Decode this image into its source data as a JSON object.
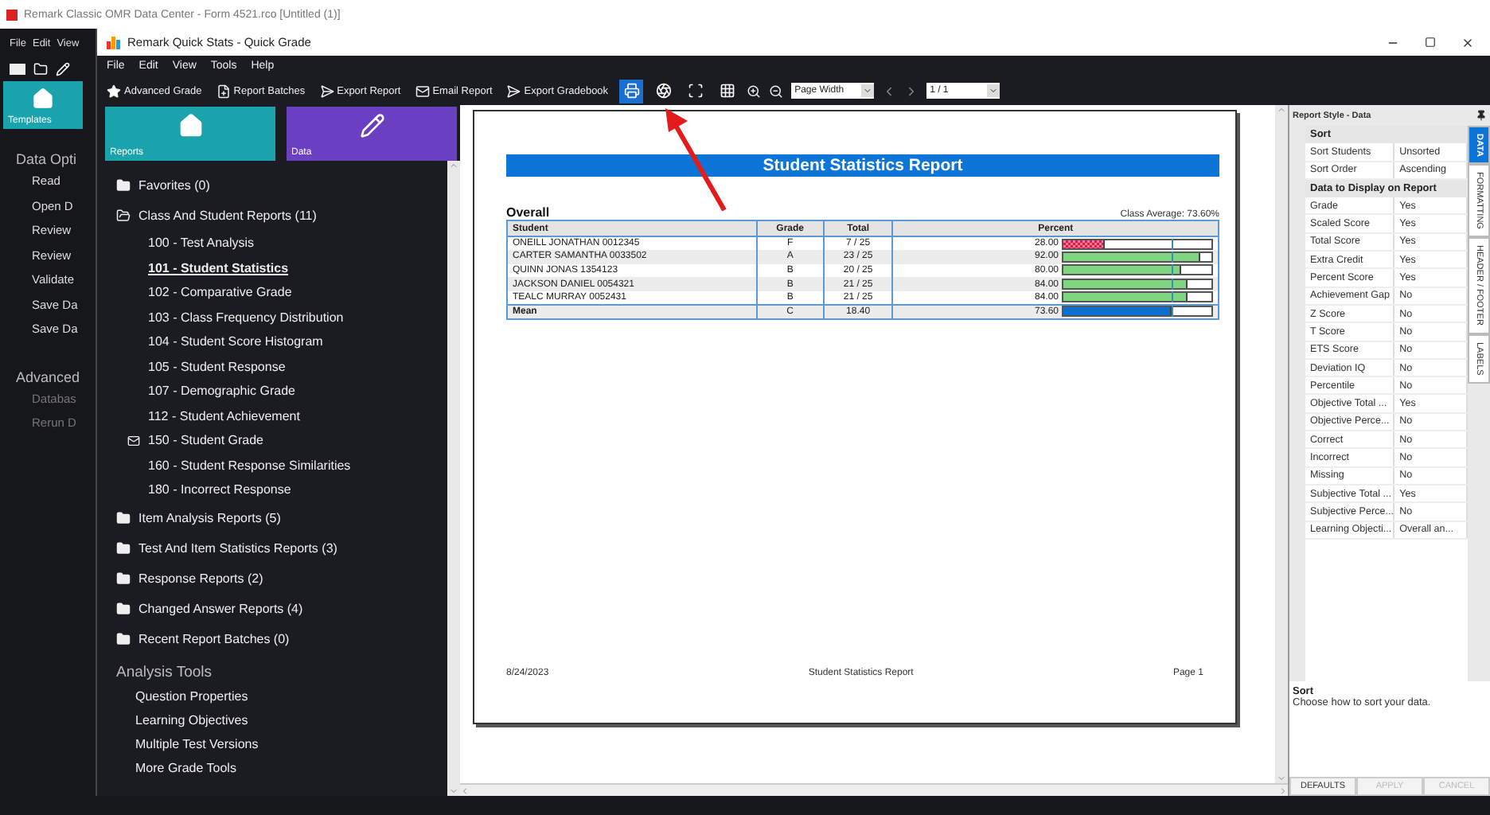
{
  "app": {
    "title": "Remark Classic OMR Data Center - Form 4521.rco [Untitled (1)]",
    "menu": [
      "File",
      "Edit",
      "View"
    ],
    "templates_tile": {
      "label": "Templates",
      "color": "#1aa3ad"
    },
    "sections": [
      {
        "heading": "Data Opti",
        "items": [
          {
            "label": "Read",
            "disabled": false
          },
          {
            "label": "Open D",
            "disabled": false
          },
          {
            "label": "Review",
            "disabled": false
          },
          {
            "label": "Review",
            "disabled": false
          },
          {
            "label": "Validate",
            "disabled": false
          },
          {
            "label": "Save Da",
            "disabled": false
          },
          {
            "label": "Save Da",
            "disabled": false
          }
        ]
      },
      {
        "heading": "Advanced",
        "items": [
          {
            "label": "Databas",
            "disabled": true
          },
          {
            "label": "Rerun D",
            "disabled": true
          }
        ]
      }
    ]
  },
  "window": {
    "title": "Remark Quick Stats - Quick Grade",
    "menu": [
      "File",
      "Edit",
      "View",
      "Tools",
      "Help"
    ],
    "toolbar": [
      "Advanced Grade",
      "Report Batches",
      "Export Report",
      "Email Report",
      "Export Gradebook"
    ],
    "view_buttons": [
      {
        "selected": true
      },
      {
        "selected": false
      },
      {
        "selected": false
      },
      {
        "selected": false
      }
    ],
    "zoom_select": "Page Width",
    "page_select": "1 / 1"
  },
  "left_panel": {
    "tiles": [
      {
        "label": "Reports",
        "color": "#1aa3ad"
      },
      {
        "label": "Data",
        "color": "#6a3fc1"
      }
    ],
    "tree": [
      {
        "label": "Favorites (0)",
        "expanded": false
      },
      {
        "label": "Class And Student Reports (11)",
        "expanded": true,
        "children": [
          {
            "label": "100 - Test Analysis",
            "selected": false,
            "kind": "plain"
          },
          {
            "label": "101 - Student Statistics",
            "selected": true,
            "kind": "plain"
          },
          {
            "label": "102 - Comparative Grade",
            "selected": false,
            "kind": "plain"
          },
          {
            "label": "103 - Class Frequency Distribution",
            "selected": false,
            "kind": "plain"
          },
          {
            "label": "104 - Student Score Histogram",
            "selected": false,
            "kind": "plain"
          },
          {
            "label": "105 - Student Response",
            "selected": false,
            "kind": "plain"
          },
          {
            "label": "107 - Demographic Grade",
            "selected": false,
            "kind": "plain"
          },
          {
            "label": "112 - Student Achievement",
            "selected": false,
            "kind": "plain"
          },
          {
            "label": "150 - Student Grade",
            "selected": false,
            "kind": "mail"
          },
          {
            "label": "160 - Student Response Similarities",
            "selected": false,
            "kind": "plain"
          },
          {
            "label": "180 - Incorrect Response",
            "selected": false,
            "kind": "plain"
          }
        ]
      },
      {
        "label": "Item Analysis Reports (5)",
        "expanded": false
      },
      {
        "label": "Test And Item Statistics Reports (3)",
        "expanded": false
      },
      {
        "label": "Response Reports (2)",
        "expanded": false
      },
      {
        "label": "Changed Answer Reports (4)",
        "expanded": false
      },
      {
        "label": "Recent Report Batches (0)",
        "expanded": false
      }
    ],
    "tools_heading": "Analysis Tools",
    "tools": [
      "Question Properties",
      "Learning Objectives",
      "Multiple Test Versions",
      "More Grade Tools"
    ]
  },
  "report": {
    "title": "Student Statistics Report",
    "section": "Overall",
    "class_average": "Class Average: 73.60%",
    "average_marker": {
      "level": 0.736
    },
    "columns": [
      "Student",
      "Grade",
      "Total",
      "Percent"
    ],
    "rows": [
      {
        "student": "ONEILL JONATHAN 0012345",
        "grade": "F",
        "total": "7  /  25",
        "percent": "28.00",
        "level": 0.28,
        "kind": "fail"
      },
      {
        "student": "CARTER SAMANTHA 0033502",
        "grade": "A",
        "total": "23  /  25",
        "percent": "92.00",
        "level": 0.92,
        "kind": "pass"
      },
      {
        "student": "QUINN JONAS 1354123",
        "grade": "B",
        "total": "20  /  25",
        "percent": "80.00",
        "level": 0.8,
        "kind": "pass"
      },
      {
        "student": "JACKSON DANIEL 0054321",
        "grade": "B",
        "total": "21  /  25",
        "percent": "84.00",
        "level": 0.84,
        "kind": "pass"
      },
      {
        "student": "TEALC MURRAY 0052431",
        "grade": "B",
        "total": "21  /  25",
        "percent": "84.00",
        "level": 0.84,
        "kind": "pass"
      },
      {
        "student": "Mean",
        "grade": "C",
        "total": "18.40",
        "percent": "73.60",
        "level": 0.736,
        "kind": "mean"
      }
    ],
    "footer": {
      "date": "8/24/2023",
      "title": "Student Statistics Report",
      "page": "Page 1"
    }
  },
  "right_panel": {
    "title": "Report Style - Data",
    "groups": [
      {
        "heading": "Sort",
        "rows": [
          {
            "name": "Sort Students",
            "value": "Unsorted"
          },
          {
            "name": "Sort Order",
            "value": "Ascending"
          }
        ]
      },
      {
        "heading": "Data to Display on Report",
        "rows": [
          {
            "name": "Grade",
            "value": "Yes"
          },
          {
            "name": "Scaled Score",
            "value": "Yes"
          },
          {
            "name": "Total Score",
            "value": "Yes"
          },
          {
            "name": "Extra Credit",
            "value": "Yes"
          },
          {
            "name": "Percent Score",
            "value": "Yes"
          },
          {
            "name": "Achievement Gap",
            "value": "No"
          },
          {
            "name": "Z Score",
            "value": "No"
          },
          {
            "name": "T Score",
            "value": "No"
          },
          {
            "name": "ETS Score",
            "value": "No"
          },
          {
            "name": "Deviation IQ",
            "value": "No"
          },
          {
            "name": "Percentile",
            "value": "No"
          },
          {
            "name": "Objective Total ...",
            "value": "Yes"
          },
          {
            "name": "Objective Perce...",
            "value": "No"
          },
          {
            "name": "Correct",
            "value": "No"
          },
          {
            "name": "Incorrect",
            "value": "No"
          },
          {
            "name": "Missing",
            "value": "No"
          },
          {
            "name": "Subjective Total ...",
            "value": "Yes"
          },
          {
            "name": "Subjective Perce...",
            "value": "No"
          },
          {
            "name": "Learning Objecti...",
            "value": "Overall an..."
          }
        ]
      }
    ],
    "help": {
      "title": "Sort",
      "text": "Choose how to sort your data."
    },
    "tabs": [
      {
        "label": "DATA",
        "selected": true
      },
      {
        "label": "FORMATTING",
        "selected": false
      },
      {
        "label": "HEADER / FOOTER",
        "selected": false
      },
      {
        "label": "LABELS",
        "selected": false
      }
    ],
    "buttons": [
      {
        "label": "DEFAULTS",
        "disabled": false
      },
      {
        "label": "APPLY",
        "disabled": true
      },
      {
        "label": "CANCEL",
        "disabled": true
      }
    ]
  }
}
